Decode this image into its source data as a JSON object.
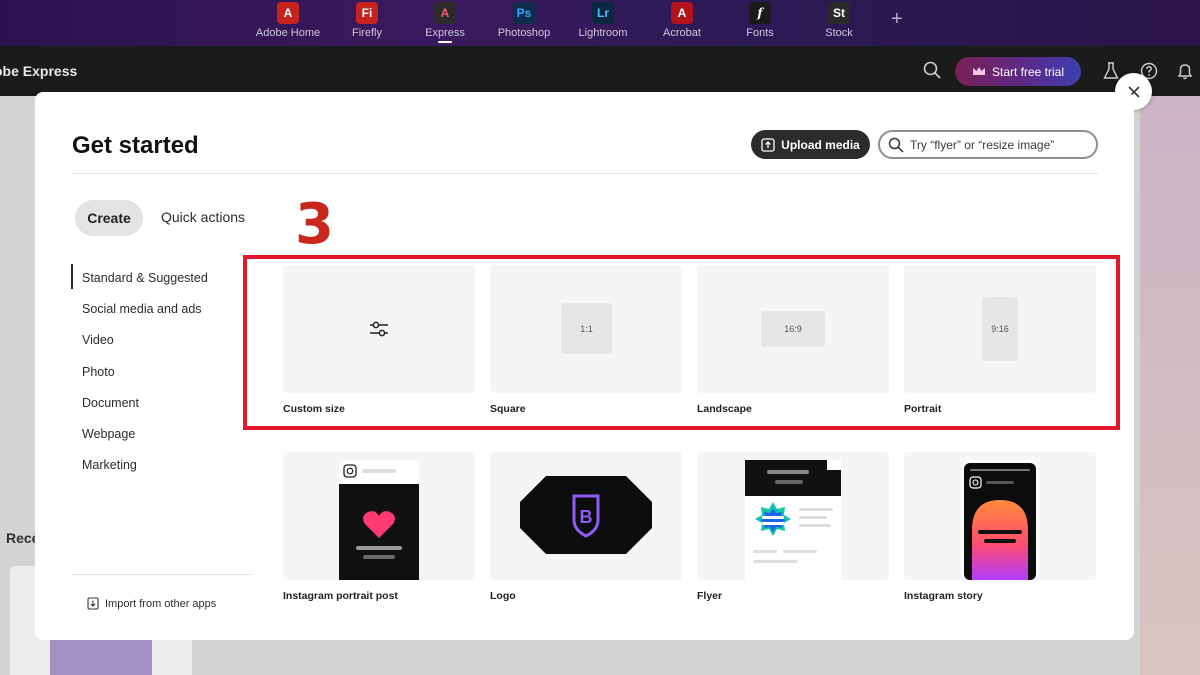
{
  "appbar": {
    "apps": [
      {
        "label": "Adobe Home",
        "glyph": "A",
        "color": "#c4241c"
      },
      {
        "label": "Firefly",
        "glyph": "Fi",
        "color": "#c4241c"
      },
      {
        "label": "Express",
        "glyph": "A",
        "color": "#2b2b2b"
      },
      {
        "label": "Photoshop",
        "glyph": "Ps",
        "color": "#0f2c4c"
      },
      {
        "label": "Lightroom",
        "glyph": "Lr",
        "color": "#0c2740"
      },
      {
        "label": "Acrobat",
        "glyph": "A",
        "color": "#b3131b"
      },
      {
        "label": "Fonts",
        "glyph": "f",
        "color": "#1a1a1a"
      },
      {
        "label": "Stock",
        "glyph": "St",
        "color": "#2a2a2a"
      }
    ],
    "plus": "+"
  },
  "header": {
    "brand": "obe Express",
    "trial_label": "Start free trial"
  },
  "background": {
    "recent_label": "Rece"
  },
  "modal": {
    "title": "Get started",
    "upload_label": "Upload media",
    "search_placeholder": "Try “flyer” or “resize image”",
    "tabs": {
      "create": "Create",
      "quick": "Quick actions"
    },
    "categories": [
      "Standard & Suggested",
      "Social media and ads",
      "Video",
      "Photo",
      "Document",
      "Webpage",
      "Marketing"
    ],
    "import_label": "Import from other apps",
    "step_marker": "3",
    "size_cards": [
      {
        "caption": "Custom size"
      },
      {
        "caption": "Square",
        "ratio": "1:1"
      },
      {
        "caption": "Landscape",
        "ratio": "16:9"
      },
      {
        "caption": "Portrait",
        "ratio": "9:16"
      }
    ],
    "template_cards": [
      {
        "caption": "Instagram portrait post"
      },
      {
        "caption": "Logo"
      },
      {
        "caption": "Flyer"
      },
      {
        "caption": "Instagram story"
      }
    ]
  },
  "colors": {
    "highlight": "#e4182d",
    "step": "#c8281c",
    "trial_gradient_start": "#7a1f55"
  }
}
